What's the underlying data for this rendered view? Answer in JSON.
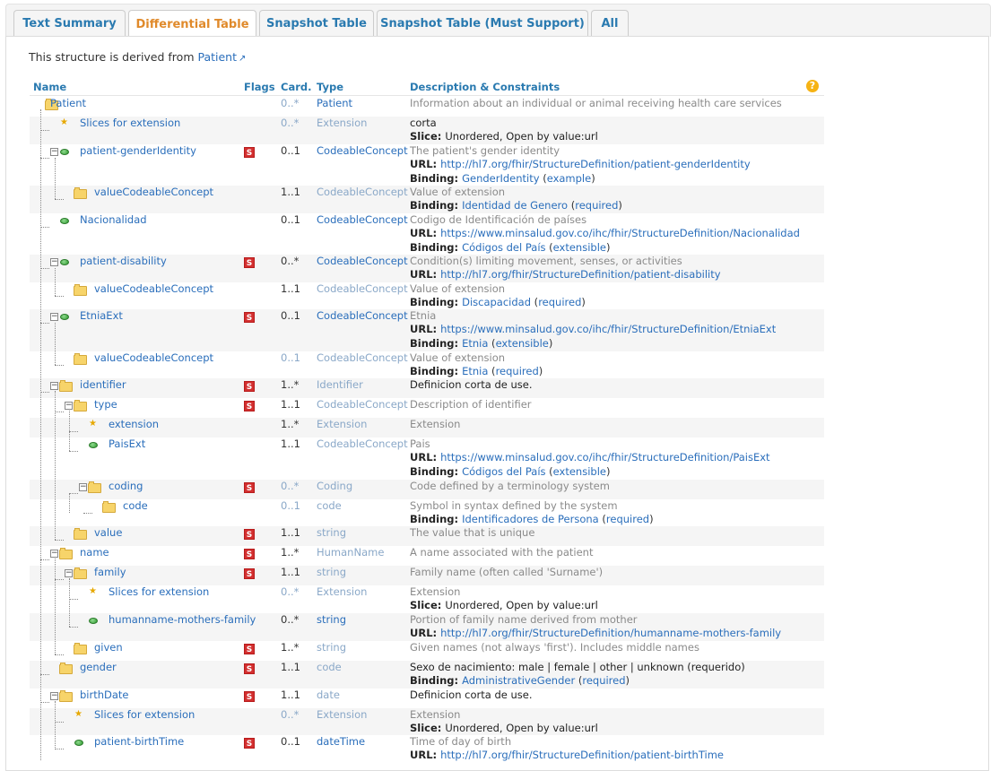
{
  "tabs": [
    {
      "label": "Text Summary",
      "active": false
    },
    {
      "label": "Differential Table",
      "active": true
    },
    {
      "label": "Snapshot Table",
      "active": false
    },
    {
      "label": "Snapshot Table (Must Support)",
      "active": false
    },
    {
      "label": "All",
      "active": false
    }
  ],
  "derived": {
    "prefix": "This structure is derived from ",
    "link": "Patient",
    "link_icon": "external-link-icon"
  },
  "table": {
    "headers": {
      "name": "Name",
      "flags": "Flags",
      "card": "Card.",
      "type": "Type",
      "desc": "Description & Constraints"
    },
    "help_icon": "?",
    "rows": [
      {
        "name": "Patient",
        "flag": "",
        "card": "0..*",
        "type": "Patient",
        "desc": [
          {
            "t": "Information about an individual or animal receiving health care services",
            "s": "g"
          }
        ]
      },
      {
        "name": "Slices for extension",
        "flag": "",
        "card": "0..*",
        "type": "Extension",
        "desc": [
          {
            "t": "corta",
            "s": "d"
          },
          {
            "label": "Slice:",
            "v": "Unordered, Open by value:url"
          }
        ]
      },
      {
        "name": "patient-genderIdentity",
        "flag": "S",
        "card": "0..1",
        "type": "CodeableConcept",
        "desc": [
          {
            "t": "The patient's gender identity",
            "s": "g"
          },
          {
            "label": "URL:",
            "link": "http://hl7.org/fhir/StructureDefinition/patient-genderIdentity"
          },
          {
            "label": "Binding:",
            "link": "GenderIdentity",
            "paren": "example"
          }
        ]
      },
      {
        "name": "valueCodeableConcept",
        "flag": "",
        "card": "1..1",
        "type": "CodeableConcept",
        "desc": [
          {
            "t": "Value of extension",
            "s": "g"
          },
          {
            "label": "Binding:",
            "link": "Identidad de Genero",
            "paren": "required"
          }
        ]
      },
      {
        "name": "Nacionalidad",
        "flag": "",
        "card": "0..1",
        "type": "CodeableConcept",
        "desc": [
          {
            "t": "Codigo de Identificación de países",
            "s": "g"
          },
          {
            "label": "URL:",
            "link": "https://www.minsalud.gov.co/ihc/fhir/StructureDefinition/Nacionalidad"
          },
          {
            "label": "Binding:",
            "link": "Códigos del País",
            "paren": "extensible"
          }
        ]
      },
      {
        "name": "patient-disability",
        "flag": "S",
        "card": "0..*",
        "type": "CodeableConcept",
        "desc": [
          {
            "t": "Condition(s) limiting movement, senses, or activities",
            "s": "g"
          },
          {
            "label": "URL:",
            "link": "http://hl7.org/fhir/StructureDefinition/patient-disability"
          }
        ]
      },
      {
        "name": "valueCodeableConcept",
        "flag": "",
        "card": "1..1",
        "type": "CodeableConcept",
        "desc": [
          {
            "t": "Value of extension",
            "s": "g"
          },
          {
            "label": "Binding:",
            "link": "Discapacidad",
            "paren": "required"
          }
        ]
      },
      {
        "name": "EtniaExt",
        "flag": "S",
        "card": "0..1",
        "type": "CodeableConcept",
        "desc": [
          {
            "t": "Etnia",
            "s": "g"
          },
          {
            "label": "URL:",
            "link": "https://www.minsalud.gov.co/ihc/fhir/StructureDefinition/EtniaExt"
          },
          {
            "label": "Binding:",
            "link": "Etnia",
            "paren": "extensible"
          }
        ]
      },
      {
        "name": "valueCodeableConcept",
        "flag": "",
        "card": "0..1",
        "type": "CodeableConcept",
        "desc": [
          {
            "t": "Value of extension",
            "s": "g"
          },
          {
            "label": "Binding:",
            "link": "Etnia",
            "paren": "required"
          }
        ]
      },
      {
        "name": "identifier",
        "flag": "S",
        "card": "1..*",
        "type": "Identifier",
        "desc": [
          {
            "t": "Definicion corta de use.",
            "s": "d"
          }
        ]
      },
      {
        "name": "type",
        "flag": "S",
        "card": "1..1",
        "type": "CodeableConcept",
        "desc": [
          {
            "t": "Description of identifier",
            "s": "g"
          }
        ]
      },
      {
        "name": "extension",
        "flag": "",
        "card": "1..*",
        "type": "Extension",
        "desc": [
          {
            "t": "Extension",
            "s": "g"
          }
        ]
      },
      {
        "name": "PaisExt",
        "flag": "",
        "card": "1..1",
        "type": "CodeableConcept",
        "desc": [
          {
            "t": "Pais",
            "s": "g"
          },
          {
            "label": "URL:",
            "link": "https://www.minsalud.gov.co/ihc/fhir/StructureDefinition/PaisExt"
          },
          {
            "label": "Binding:",
            "link": "Códigos del País",
            "paren": "extensible"
          }
        ]
      },
      {
        "name": "coding",
        "flag": "S",
        "card": "0..*",
        "type": "Coding",
        "desc": [
          {
            "t": "Code defined by a terminology system",
            "s": "g"
          }
        ]
      },
      {
        "name": "code",
        "flag": "",
        "card": "0..1",
        "type": "code",
        "desc": [
          {
            "t": "Symbol in syntax defined by the system",
            "s": "g"
          },
          {
            "label": "Binding:",
            "link": "Identificadores de Persona",
            "paren": "required"
          }
        ]
      },
      {
        "name": "value",
        "flag": "S",
        "card": "1..1",
        "type": "string",
        "desc": [
          {
            "t": "The value that is unique",
            "s": "g"
          }
        ]
      },
      {
        "name": "name",
        "flag": "S",
        "card": "1..*",
        "type": "HumanName",
        "desc": [
          {
            "t": "A name associated with the patient",
            "s": "g"
          }
        ]
      },
      {
        "name": "family",
        "flag": "S",
        "card": "1..1",
        "type": "string",
        "desc": [
          {
            "t": "Family name (often called 'Surname')",
            "s": "g"
          }
        ]
      },
      {
        "name": "Slices for extension",
        "flag": "",
        "card": "0..*",
        "type": "Extension",
        "desc": [
          {
            "t": "Extension",
            "s": "g"
          },
          {
            "label": "Slice:",
            "v": "Unordered, Open by value:url"
          }
        ]
      },
      {
        "name": "humanname-mothers-family",
        "flag": "",
        "card": "0..*",
        "type": "string",
        "desc": [
          {
            "t": "Portion of family name derived from mother",
            "s": "g"
          },
          {
            "label": "URL:",
            "link": "http://hl7.org/fhir/StructureDefinition/humanname-mothers-family"
          }
        ]
      },
      {
        "name": "given",
        "flag": "S",
        "card": "1..*",
        "type": "string",
        "desc": [
          {
            "t": "Given names (not always 'first'). Includes middle names",
            "s": "g"
          }
        ]
      },
      {
        "name": "gender",
        "flag": "S",
        "card": "1..1",
        "type": "code",
        "desc": [
          {
            "t": "Sexo de nacimiento: male | female | other | unknown (requerido)",
            "s": "d"
          },
          {
            "label": "Binding:",
            "link": "AdministrativeGender",
            "paren": "required"
          }
        ]
      },
      {
        "name": "birthDate",
        "flag": "S",
        "card": "1..1",
        "type": "date",
        "desc": [
          {
            "t": "Definicion corta de use.",
            "s": "d"
          }
        ]
      },
      {
        "name": "Slices for extension",
        "flag": "",
        "card": "0..*",
        "type": "Extension",
        "desc": [
          {
            "t": "Extension",
            "s": "g"
          },
          {
            "label": "Slice:",
            "v": "Unordered, Open by value:url"
          }
        ]
      },
      {
        "name": "patient-birthTime",
        "flag": "S",
        "card": "0..1",
        "type": "dateTime",
        "desc": [
          {
            "t": "Time of day of birth",
            "s": "g"
          },
          {
            "label": "URL:",
            "link": "http://hl7.org/fhir/StructureDefinition/patient-birthTime"
          }
        ]
      }
    ]
  }
}
